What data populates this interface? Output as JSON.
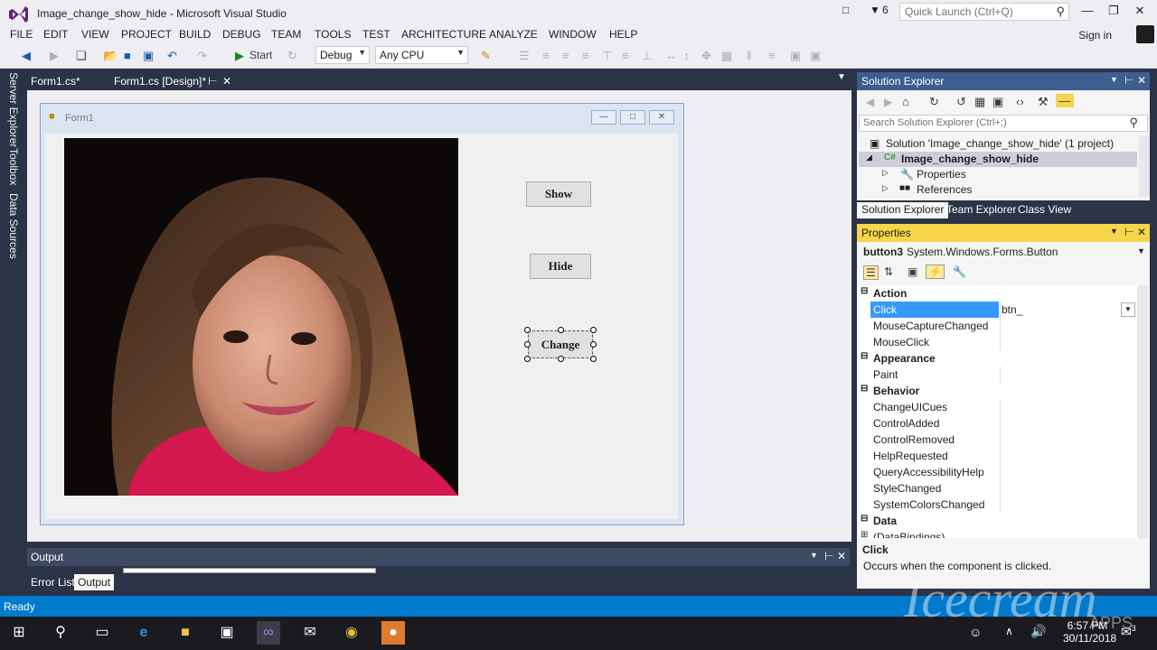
{
  "window": {
    "title": "Image_change_show_hide - Microsoft Visual Studio",
    "notif_count": "6",
    "quick_launch_placeholder": "Quick Launch (Ctrl+Q)",
    "sign_in": "Sign in"
  },
  "menu": [
    "FILE",
    "EDIT",
    "VIEW",
    "PROJECT",
    "BUILD",
    "DEBUG",
    "TEAM",
    "TOOLS",
    "TEST",
    "ARCHITECTURE",
    "ANALYZE",
    "WINDOW",
    "HELP"
  ],
  "toolbar": {
    "start": "Start",
    "config": "Debug",
    "platform": "Any CPU"
  },
  "left_tabs": [
    "Server Explorer",
    "Toolbox",
    "Data Sources"
  ],
  "doc_tabs": [
    "Form1.cs*",
    "Form1.cs [Design]*"
  ],
  "form": {
    "title": "Form1",
    "buttons": [
      "Show",
      "Hide",
      "Change"
    ]
  },
  "output": {
    "title": "Output",
    "tabs": [
      "Error List",
      "Output"
    ]
  },
  "solution_explorer": {
    "title": "Solution Explorer",
    "search_placeholder": "Search Solution Explorer (Ctrl+;)",
    "solution": "Solution 'Image_change_show_hide' (1 project)",
    "project": "Image_change_show_hide",
    "items": [
      "Properties",
      "References"
    ],
    "tabs": [
      "Solution Explorer",
      "Team Explorer",
      "Class View"
    ]
  },
  "properties": {
    "title": "Properties",
    "object": "button3",
    "object_type": "System.Windows.Forms.Button",
    "rows": [
      {
        "kind": "cat",
        "name": "Action"
      },
      {
        "kind": "prop",
        "name": "Click",
        "value": "btn_",
        "selected": true
      },
      {
        "kind": "prop",
        "name": "MouseCaptureChanged",
        "value": ""
      },
      {
        "kind": "prop",
        "name": "MouseClick",
        "value": ""
      },
      {
        "kind": "cat",
        "name": "Appearance"
      },
      {
        "kind": "prop",
        "name": "Paint",
        "value": ""
      },
      {
        "kind": "cat",
        "name": "Behavior"
      },
      {
        "kind": "prop",
        "name": "ChangeUICues",
        "value": ""
      },
      {
        "kind": "prop",
        "name": "ControlAdded",
        "value": ""
      },
      {
        "kind": "prop",
        "name": "ControlRemoved",
        "value": ""
      },
      {
        "kind": "prop",
        "name": "HelpRequested",
        "value": ""
      },
      {
        "kind": "prop",
        "name": "QueryAccessibilityHelp",
        "value": ""
      },
      {
        "kind": "prop",
        "name": "StyleChanged",
        "value": ""
      },
      {
        "kind": "prop",
        "name": "SystemColorsChanged",
        "value": ""
      },
      {
        "kind": "cat",
        "name": "Data"
      },
      {
        "kind": "sub",
        "name": "(DataBindings)",
        "value": ""
      }
    ],
    "desc_title": "Click",
    "desc_text": "Occurs when the component is clicked."
  },
  "status": {
    "text": "Ready"
  },
  "taskbar": {
    "time": "6:57 PM",
    "date": "30/11/2018",
    "notifications": "3"
  },
  "watermark": {
    "text": "Icecream",
    "sub": "APPS"
  }
}
